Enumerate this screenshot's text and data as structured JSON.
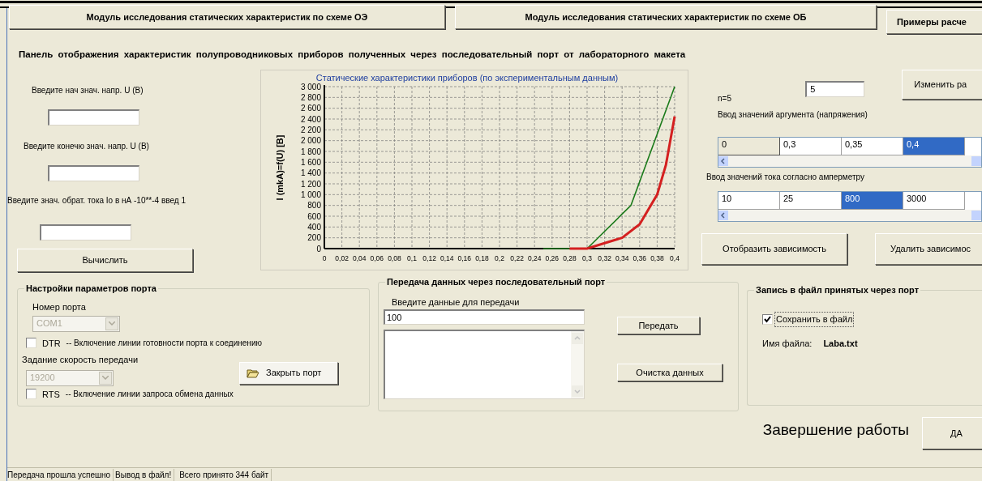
{
  "top_buttons": [
    {
      "label": "Модуль исследования статических  характеристик  по схеме ОЭ"
    },
    {
      "label": "Модуль исследования статических  характеристик по схеме ОБ"
    },
    {
      "label": "Примеры расче"
    }
  ],
  "heading": "Панель  отображения  характеристик  полупроводниковых  приборов  полученных  через  последовательный   порт  от  лабораторного макета",
  "calc_panel": {
    "fields": [
      {
        "label": "Введите  нач знач. напр. U (B)"
      },
      {
        "label": "Введите конечю знач. напр. U (B)"
      },
      {
        "label": "Введите  знач. обрат. тока Io в нА -10**-4 введ 1"
      }
    ],
    "button": "Вычислить"
  },
  "chart": {
    "chart_data": {
      "type": "line",
      "title": "Статические характеристики приборов (по экспериментальным данным)",
      "ylabel": "I (mkA)=f(U) [B]",
      "grid": true,
      "series": [
        {
          "color": "#1a7a1a",
          "x": [
            0.25,
            0.3,
            0.35,
            0.4
          ],
          "values": [
            0,
            0,
            800,
            3000
          ]
        },
        {
          "color": "#d42020",
          "x": [
            0.28,
            0.3,
            0.32,
            0.34,
            0.36,
            0.38,
            0.39,
            0.4
          ],
          "values": [
            0,
            0,
            100,
            200,
            450,
            1000,
            1550,
            2450
          ]
        }
      ],
      "xlim": [
        0,
        0.4
      ],
      "ylim": [
        0,
        3000
      ],
      "xticks": [
        {
          "value": 0,
          "label": "0"
        },
        {
          "value": 0.02,
          "label": "0,02"
        },
        {
          "value": 0.04,
          "label": "0,04"
        },
        {
          "value": 0.06,
          "label": "0,06"
        },
        {
          "value": 0.08,
          "label": "0,08"
        },
        {
          "value": 0.1,
          "label": "0,1"
        },
        {
          "value": 0.12,
          "label": "0,12"
        },
        {
          "value": 0.14,
          "label": "0,14"
        },
        {
          "value": 0.16,
          "label": "0,16"
        },
        {
          "value": 0.18,
          "label": "0,18"
        },
        {
          "value": 0.2,
          "label": "0,2"
        },
        {
          "value": 0.22,
          "label": "0,22"
        },
        {
          "value": 0.24,
          "label": "0,24"
        },
        {
          "value": 0.26,
          "label": "0,26"
        },
        {
          "value": 0.28,
          "label": "0,28"
        },
        {
          "value": 0.3,
          "label": "0,3"
        },
        {
          "value": 0.32,
          "label": "0,32"
        },
        {
          "value": 0.34,
          "label": "0,34"
        },
        {
          "value": 0.36,
          "label": "0,36"
        },
        {
          "value": 0.38,
          "label": "0,38"
        },
        {
          "value": 0.4,
          "label": "0,4"
        }
      ],
      "yticks": [
        {
          "value": 0,
          "label": "0"
        },
        {
          "value": 200,
          "label": "200"
        },
        {
          "value": 400,
          "label": "400"
        },
        {
          "value": 600,
          "label": "600"
        },
        {
          "value": 800,
          "label": "800"
        },
        {
          "value": 1000,
          "label": "1 000"
        },
        {
          "value": 1200,
          "label": "1 200"
        },
        {
          "value": 1400,
          "label": "1 400"
        },
        {
          "value": 1600,
          "label": "1 600"
        },
        {
          "value": 1800,
          "label": "1 800"
        },
        {
          "value": 2000,
          "label": "2 000"
        },
        {
          "value": 2200,
          "label": "2 200"
        },
        {
          "value": 2400,
          "label": "2 400"
        },
        {
          "value": 2600,
          "label": "2 600"
        },
        {
          "value": 2800,
          "label": "2 800"
        },
        {
          "value": 3000,
          "label": "3 000"
        }
      ]
    }
  },
  "input_panel": {
    "n_label": "n=5",
    "n_value": "5",
    "change_button": "Изменить ра",
    "voltage_label": "Ввод  значений  аргумента (напряжения)",
    "voltage_cells": [
      {
        "value": "0",
        "fixed": true,
        "selected": false
      },
      {
        "value": "0,3",
        "fixed": false,
        "selected": false
      },
      {
        "value": "0,35",
        "fixed": false,
        "selected": false
      },
      {
        "value": "0,4",
        "fixed": false,
        "selected": true
      }
    ],
    "current_label": "Ввод  значений   тока  согласно  амперметру",
    "current_cells": [
      {
        "value": "10",
        "fixed": false,
        "selected": false
      },
      {
        "value": "25",
        "fixed": false,
        "selected": false
      },
      {
        "value": "800",
        "fixed": false,
        "selected": true
      },
      {
        "value": "3000",
        "fixed": false,
        "selected": false
      }
    ],
    "buttons": [
      "Отобразить зависимость",
      "Удалить зависимос"
    ]
  },
  "port_settings": {
    "title": "Настройки параметров порта",
    "port_label": "Номер порта",
    "port_value": "COM1",
    "port_disabled": true,
    "dtr": {
      "label": "DTR",
      "note": "-- Включение  линии готовности порта к соединению",
      "checked": false
    },
    "speed_label": "Задание  скорость передачи",
    "speed_value": "19200",
    "speed_disabled": true,
    "close_button": "Закрыть порт",
    "rts": {
      "label": "RTS",
      "note": "-- Включение  линии запроса обмена данных",
      "checked": false
    }
  },
  "transfer": {
    "title": "Передача данных через последовательный порт",
    "input_label": "Введите данные для передачи",
    "input_value": "100",
    "send_button": "Передать",
    "clear_button": "Очистка данных"
  },
  "file_record": {
    "title": "Запись в файл принятых через  порт",
    "save": {
      "label": "Сохранить в файл",
      "checked": true
    },
    "file_label": "Имя файла:",
    "file_name": "Laba.txt"
  },
  "finish": {
    "label": "Завершение работы",
    "button": "ДА"
  },
  "status_bar": [
    "Передача прошла успешно",
    "Вывод в файл!",
    "Всего принято 344 байт"
  ]
}
